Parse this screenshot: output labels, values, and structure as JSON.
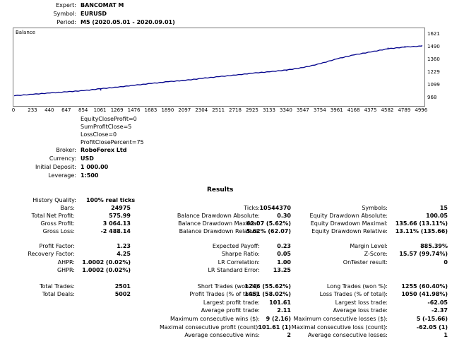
{
  "header": [
    {
      "label": "Expert:",
      "value": "BANCOMAT M"
    },
    {
      "label": "Symbol:",
      "value": "EURUSD"
    },
    {
      "label": "Period:",
      "value": "M5 (2020.05.01 - 2020.09.01)"
    }
  ],
  "chart_data": {
    "type": "line",
    "title": "Balance",
    "ylim": [
      968,
      1621
    ],
    "yticks": [
      "1621",
      "1490",
      "1360",
      "1229",
      "1099",
      "968"
    ],
    "xticks": [
      "0",
      "233",
      "440",
      "647",
      "854",
      "1061",
      "1269",
      "1476",
      "1683",
      "1890",
      "2097",
      "2304",
      "2511",
      "2718",
      "2925",
      "3133",
      "3340",
      "3547",
      "3754",
      "3961",
      "4168",
      "4375",
      "4582",
      "4789",
      "4996"
    ],
    "xlim": [
      0,
      5002
    ],
    "series": [
      {
        "values": [
          [
            0,
            1000
          ],
          [
            233,
            1015
          ],
          [
            440,
            1028
          ],
          [
            647,
            1040
          ],
          [
            854,
            1052
          ],
          [
            1061,
            1072
          ],
          [
            1269,
            1088
          ],
          [
            1476,
            1108
          ],
          [
            1683,
            1126
          ],
          [
            1890,
            1144
          ],
          [
            2097,
            1158
          ],
          [
            2304,
            1178
          ],
          [
            2511,
            1196
          ],
          [
            2718,
            1212
          ],
          [
            2925,
            1232
          ],
          [
            3133,
            1246
          ],
          [
            3340,
            1264
          ],
          [
            3547,
            1290
          ],
          [
            3754,
            1330
          ],
          [
            3961,
            1380
          ],
          [
            4168,
            1420
          ],
          [
            4375,
            1450
          ],
          [
            4582,
            1482
          ],
          [
            4789,
            1500
          ],
          [
            4996,
            1510
          ]
        ]
      }
    ],
    "spikes": [
      [
        1061,
        1072,
        -18
      ],
      [
        3340,
        1264,
        -10
      ],
      [
        4582,
        1482,
        12
      ],
      [
        4789,
        1500,
        10
      ],
      [
        4996,
        1510,
        8
      ]
    ],
    "color": "#00008b",
    "grid": false
  },
  "inputs": [
    "EquityCloseProfit=0",
    "SumProfitClose=5",
    "LossClose=0",
    "ProfitClosePercent=75"
  ],
  "account": [
    {
      "label": "Broker:",
      "value": "RoboForex Ltd"
    },
    {
      "label": "Currency:",
      "value": "USD"
    },
    {
      "label": "Initial Deposit:",
      "value": "1 000.00"
    },
    {
      "label": "Leverage:",
      "value": "1:500"
    }
  ],
  "results_title": "Results",
  "history_quality": {
    "label": "History Quality:",
    "value": "100% real ticks"
  },
  "rows": [
    [
      {
        "l": "Bars:",
        "v": "24975"
      },
      {
        "l": "Ticks:",
        "v": "10544370"
      },
      {
        "l": "Symbols:",
        "v": "15"
      }
    ],
    [
      {
        "l": "Total Net Profit:",
        "v": "575.99"
      },
      {
        "l": "Balance Drawdown Absolute:",
        "v": "0.30"
      },
      {
        "l": "Equity Drawdown Absolute:",
        "v": "100.05"
      }
    ],
    [
      {
        "l": "Gross Profit:",
        "v": "3 064.13"
      },
      {
        "l": "Balance Drawdown Maximal:",
        "v": "62.07 (5.62%)"
      },
      {
        "l": "Equity Drawdown Maximal:",
        "v": "135.66 (13.11%)"
      }
    ],
    [
      {
        "l": "Gross Loss:",
        "v": "-2 488.14"
      },
      {
        "l": "Balance Drawdown Relative:",
        "v": "5.62% (62.07)"
      },
      {
        "l": "Equity Drawdown Relative:",
        "v": "13.11% (135.66)"
      }
    ],
    [
      {
        "l": "Profit Factor:",
        "v": "1.23"
      },
      {
        "l": "Expected Payoff:",
        "v": "0.23"
      },
      {
        "l": "Margin Level:",
        "v": "885.39%"
      }
    ],
    [
      {
        "l": "Recovery Factor:",
        "v": "4.25"
      },
      {
        "l": "Sharpe Ratio:",
        "v": "0.05"
      },
      {
        "l": "Z-Score:",
        "v": "15.57 (99.74%)"
      }
    ],
    [
      {
        "l": "AHPR:",
        "v": "1.0002 (0.02%)"
      },
      {
        "l": "LR Correlation:",
        "v": "1.00"
      },
      {
        "l": "OnTester result:",
        "v": "0"
      }
    ],
    [
      {
        "l": "GHPR:",
        "v": "1.0002 (0.02%)"
      },
      {
        "l": "LR Standard Error:",
        "v": "13.25"
      },
      {
        "l": "",
        "v": ""
      }
    ],
    [
      {
        "l": "Total Trades:",
        "v": "2501"
      },
      {
        "l": "Short Trades (won %):",
        "v": "1246 (55.62%)"
      },
      {
        "l": "Long Trades (won %):",
        "v": "1255 (60.40%)"
      }
    ],
    [
      {
        "l": "Total Deals:",
        "v": "5002"
      },
      {
        "l": "Profit Trades (% of total):",
        "v": "1451 (58.02%)"
      },
      {
        "l": "Loss Trades (% of total):",
        "v": "1050 (41.98%)"
      }
    ],
    [
      {
        "l": "",
        "v": ""
      },
      {
        "l": "Largest profit trade:",
        "v": "101.61"
      },
      {
        "l": "Largest loss trade:",
        "v": "-62.05"
      }
    ],
    [
      {
        "l": "",
        "v": ""
      },
      {
        "l": "Average profit trade:",
        "v": "2.11"
      },
      {
        "l": "Average loss trade:",
        "v": "-2.37"
      }
    ],
    [
      {
        "l": "",
        "v": ""
      },
      {
        "l": "Maximum consecutive wins ($):",
        "v": "9 (2.16)"
      },
      {
        "l": "Maximum consecutive losses ($):",
        "v": "5 (-15.66)"
      }
    ],
    [
      {
        "l": "",
        "v": ""
      },
      {
        "l": "Maximal consecutive profit (count):",
        "v": "101.61 (1)"
      },
      {
        "l": "Maximal consecutive loss (count):",
        "v": "-62.05 (1)"
      }
    ],
    [
      {
        "l": "",
        "v": ""
      },
      {
        "l": "Average consecutive wins:",
        "v": "2"
      },
      {
        "l": "Average consecutive losses:",
        "v": "1"
      }
    ]
  ]
}
